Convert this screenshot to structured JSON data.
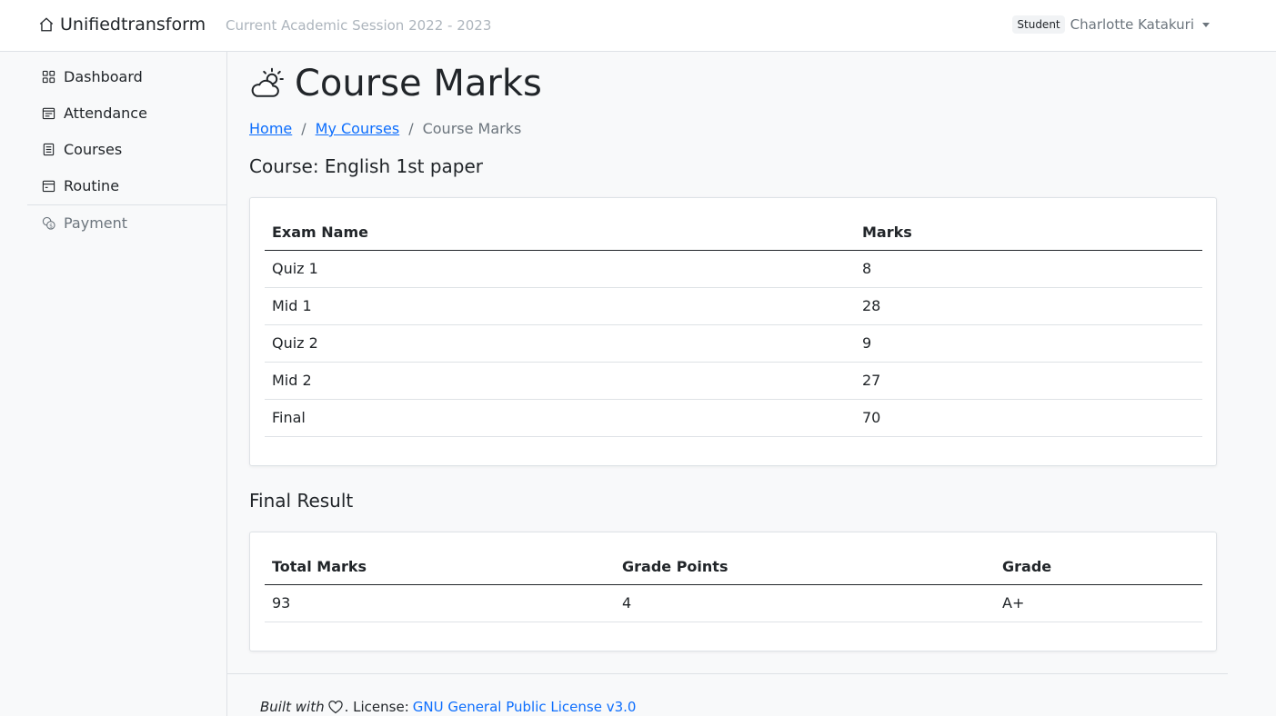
{
  "navbar": {
    "brand": "Unifiedtransform",
    "session": "Current Academic Session 2022 - 2023",
    "role_badge": "Student",
    "user_name": "Charlotte Katakuri"
  },
  "sidebar": {
    "watermark": "Unifiedtransform",
    "items": [
      {
        "label": "Dashboard",
        "icon": "grid-icon"
      },
      {
        "label": "Attendance",
        "icon": "calendar-check-icon"
      },
      {
        "label": "Courses",
        "icon": "journal-icon"
      },
      {
        "label": "Routine",
        "icon": "calendar-icon"
      },
      {
        "label": "Payment",
        "icon": "coin-icon"
      }
    ]
  },
  "main": {
    "title": "Course Marks",
    "title_icon": "cloud-sun-icon",
    "breadcrumb": [
      "Home",
      "My Courses",
      "Course Marks"
    ],
    "course_heading": "Course: English 1st paper",
    "marks_table": {
      "headers": [
        "Exam Name",
        "Marks"
      ],
      "rows": [
        [
          "Quiz 1",
          "8"
        ],
        [
          "Mid 1",
          "28"
        ],
        [
          "Quiz 2",
          "9"
        ],
        [
          "Mid 2",
          "27"
        ],
        [
          "Final",
          "70"
        ]
      ]
    },
    "result_heading": "Final Result",
    "result_table": {
      "headers": [
        "Total Marks",
        "Grade Points",
        "Grade"
      ],
      "rows": [
        [
          "93",
          "4",
          "A+"
        ]
      ]
    }
  },
  "footer": {
    "built_with": "Built with",
    "license_prefix": ". License:",
    "license_link": "GNU General Public License v3.0"
  },
  "colors": {
    "link": "#0d6efd",
    "muted": "#6c757d",
    "background": "#f8f9fa"
  }
}
